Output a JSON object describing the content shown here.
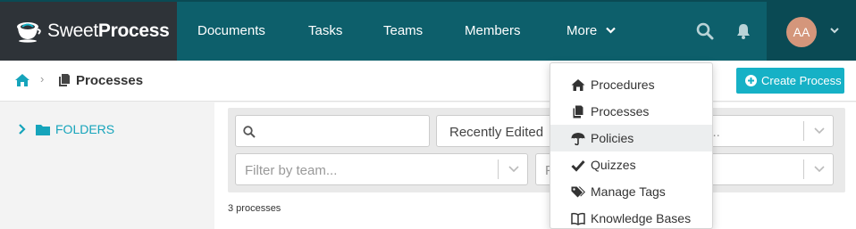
{
  "app": {
    "brand_light": "Sweet",
    "brand_bold": "Process"
  },
  "nav": {
    "items": [
      "Documents",
      "Tasks",
      "Teams",
      "Members"
    ],
    "more_label": "More",
    "avatar_initials": "AA"
  },
  "breadcrumb": {
    "current": "Processes"
  },
  "actions": {
    "create_label": "Create Process"
  },
  "sidebar": {
    "folders_label": "FOLDERS"
  },
  "filters": {
    "search_placeholder": "",
    "sort_value": "Recently Edited",
    "tag_placeholder_partial": "g...",
    "team_placeholder": "Filter by team...",
    "second_placeholder_partial": "F"
  },
  "results": {
    "count_text": "3 processes"
  },
  "more_menu": {
    "items": [
      {
        "label": "Procedures",
        "icon": "home-icon"
      },
      {
        "label": "Processes",
        "icon": "documents-icon"
      },
      {
        "label": "Policies",
        "icon": "umbrella-icon"
      },
      {
        "label": "Quizzes",
        "icon": "check-icon"
      },
      {
        "label": "Manage Tags",
        "icon": "tags-icon"
      },
      {
        "label": "Knowledge Bases",
        "icon": "book-icon"
      }
    ],
    "hovered_index": 2
  },
  "colors": {
    "nav_bg": "#0d5f6b",
    "logo_bg": "#2e3338",
    "accent": "#16b1c6",
    "avatar_bg": "#d4967b"
  }
}
